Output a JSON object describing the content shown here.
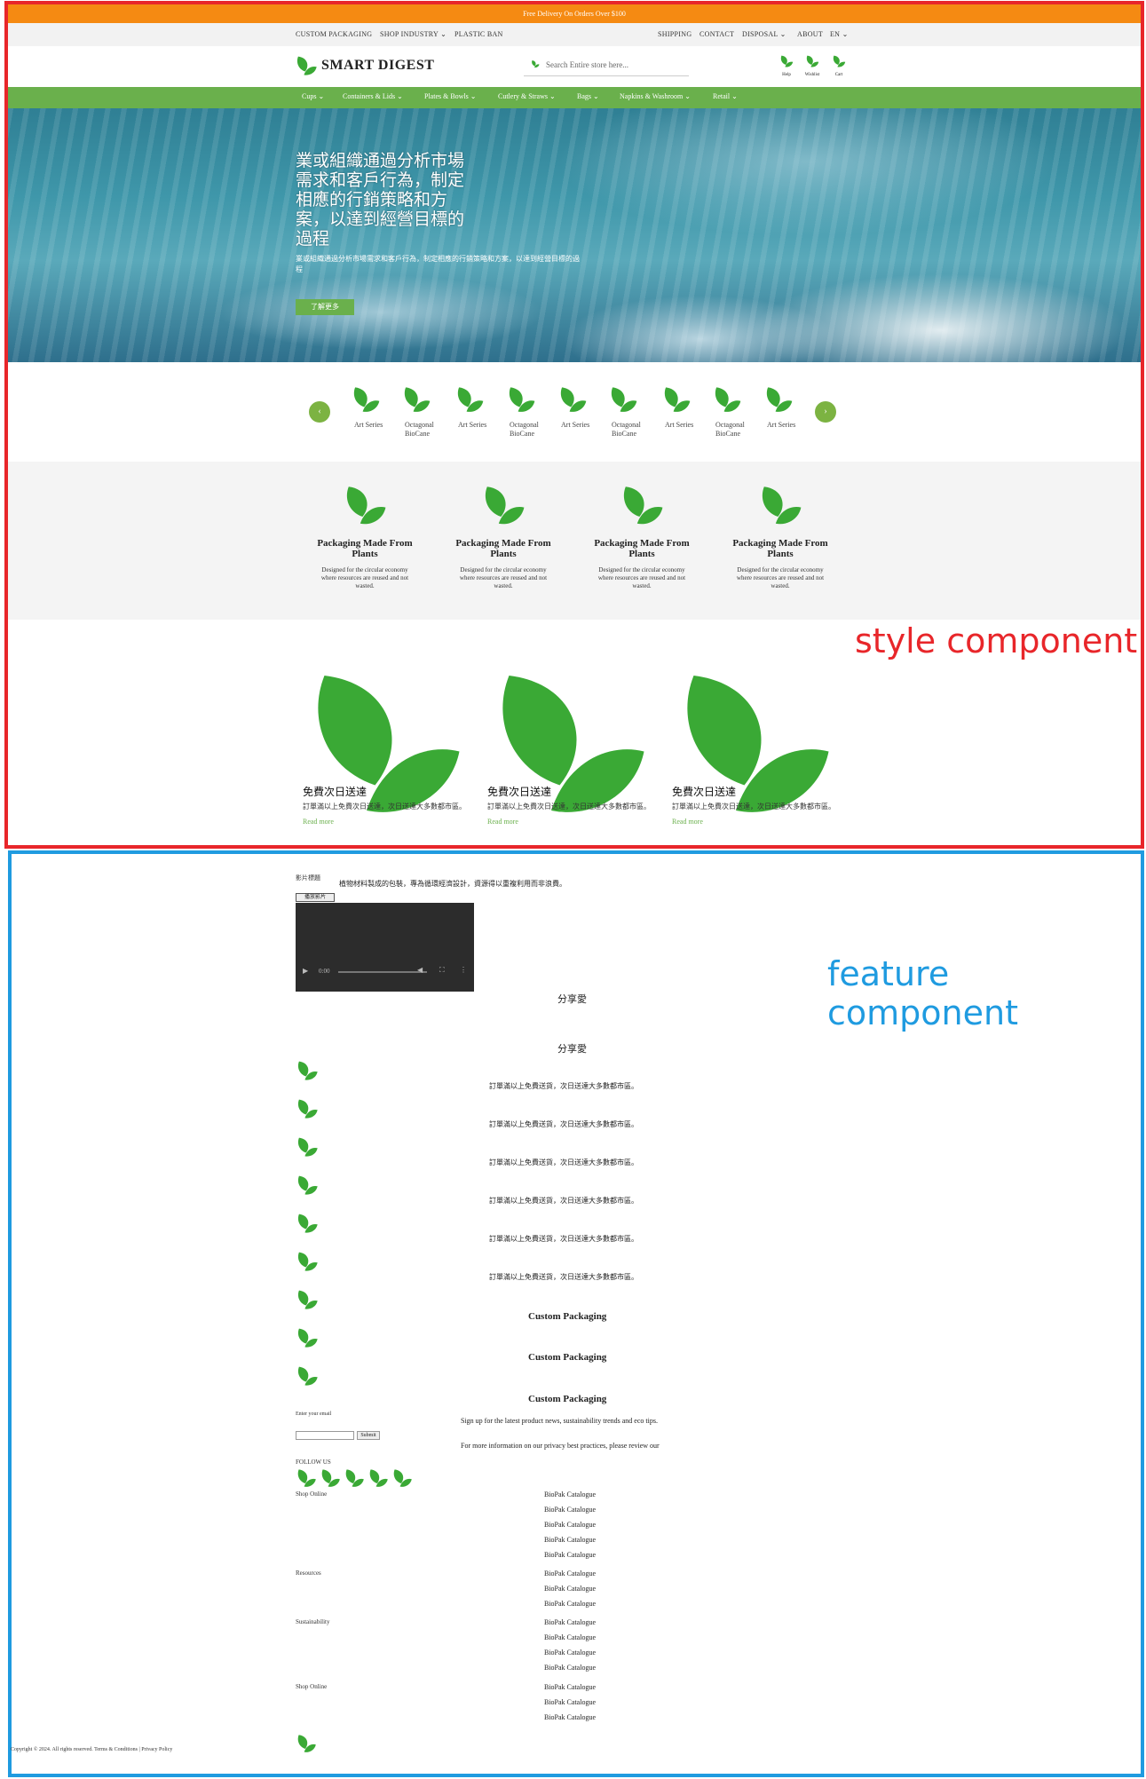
{
  "annotations": {
    "style_label": "style component",
    "feature_label": "feature component",
    "style_color": "#e8262a",
    "feature_color": "#1f9be0"
  },
  "top_banner": {
    "text": "Free Delivery On Orders Over $100"
  },
  "utility_nav": {
    "left": [
      "CUSTOM PACKAGING",
      "SHOP INDUSTRY",
      "PLASTIC BAN"
    ],
    "right": [
      "SHIPPING",
      "CONTACT",
      "DISPOSAL",
      "ABOUT",
      "EN"
    ]
  },
  "header": {
    "logo_text": "SMART DIGEST",
    "search_placeholder": "Search Entire store here...",
    "icons": [
      {
        "icon": "leaf-icon",
        "label": "Help"
      },
      {
        "icon": "leaf-icon",
        "label": "Wishlist"
      },
      {
        "icon": "leaf-icon",
        "label": "Cart"
      }
    ]
  },
  "main_nav": [
    "Cups",
    "Containers & Lids",
    "Plates & Bowls",
    "Cutlery & Straws",
    "Bags",
    "Napkins & Washroom",
    "Retail"
  ],
  "hero": {
    "title": "業或組織通過分析市場需求和客戶行為，制定相應的行銷策略和方案，以達到經營目標的過程",
    "subtitle": "業或組織通過分析市場需求和客戶行為，制定相應的行銷策略和方案，以達到經營目標的過程",
    "button": "了解更多"
  },
  "carousel": {
    "prev": "‹",
    "next": "›",
    "items": [
      "Art Series",
      "Octagonal BioCane",
      "Art Series",
      "Octagonal BioCane",
      "Art Series",
      "Octagonal BioCane",
      "Art Series",
      "Octagonal BioCane",
      "Art Series"
    ]
  },
  "features": [
    {
      "title": "Packaging Made From Plants",
      "desc": "Designed for the circular economy where resources are reused and not wasted."
    },
    {
      "title": "Packaging Made From Plants",
      "desc": "Designed for the circular economy where resources are reused and not wasted."
    },
    {
      "title": "Packaging Made From Plants",
      "desc": "Designed for the circular economy where resources are reused and not wasted."
    },
    {
      "title": "Packaging Made From Plants",
      "desc": "Designed for the circular economy where resources are reused and not wasted."
    }
  ],
  "promos": [
    {
      "title": "免費次日送達",
      "desc": "訂單滿以上免費次日送達，次日送達大多數都市區。",
      "more": "Read more"
    },
    {
      "title": "免費次日送達",
      "desc": "訂單滿以上免費次日送達，次日送達大多數都市區。",
      "more": "Read more"
    },
    {
      "title": "免費次日送達",
      "desc": "訂單滿以上免費次日送達，次日送達大多數都市區。",
      "more": "Read more"
    }
  ],
  "feature_section": {
    "small_label": "影片標題",
    "intro": "植物材料製成的包裝，專為循環經濟設計，資源得以重複利用而非浪費。",
    "video_button": "播放影片",
    "video_time": "0:00",
    "share_heads": [
      "分享愛",
      "分享愛"
    ],
    "list_lines": [
      "訂單滿以上免費送貨，次日送達大多數都市區。",
      "訂單滿以上免費送貨，次日送達大多數都市區。",
      "訂單滿以上免費送貨，次日送達大多數都市區。",
      "訂單滿以上免費送貨，次日送達大多數都市區。",
      "訂單滿以上免費送貨，次日送達大多數都市區。",
      "訂單滿以上免費送貨，次日送達大多數都市區。"
    ],
    "cp_heads": [
      "Custom Packaging",
      "Custom Packaging",
      "Custom Packaging"
    ],
    "signup_text": "Sign up for the latest product news, sustainability trends and eco tips.",
    "privacy_text": "For more information on our privacy best practices, please review our",
    "email_label": "Enter your email",
    "email_button": "Submit",
    "follow_label": "FOLLOW US",
    "groups": [
      {
        "label": "Shop Online",
        "items": [
          "BioPak Catalogue",
          "BioPak Catalogue",
          "BioPak Catalogue",
          "BioPak Catalogue",
          "BioPak Catalogue"
        ]
      },
      {
        "label": "Resources",
        "items": [
          "BioPak Catalogue",
          "BioPak Catalogue",
          "BioPak Catalogue"
        ]
      },
      {
        "label": "Sustainability",
        "items": [
          "BioPak Catalogue",
          "BioPak Catalogue",
          "BioPak Catalogue",
          "BioPak Catalogue"
        ]
      },
      {
        "label": "Shop Online",
        "items": [
          "BioPak Catalogue",
          "BioPak Catalogue",
          "BioPak Catalogue"
        ]
      }
    ],
    "copyright": "Copyright © 2024. All rights reserved. Terms & Conditions | Privacy Policy"
  }
}
